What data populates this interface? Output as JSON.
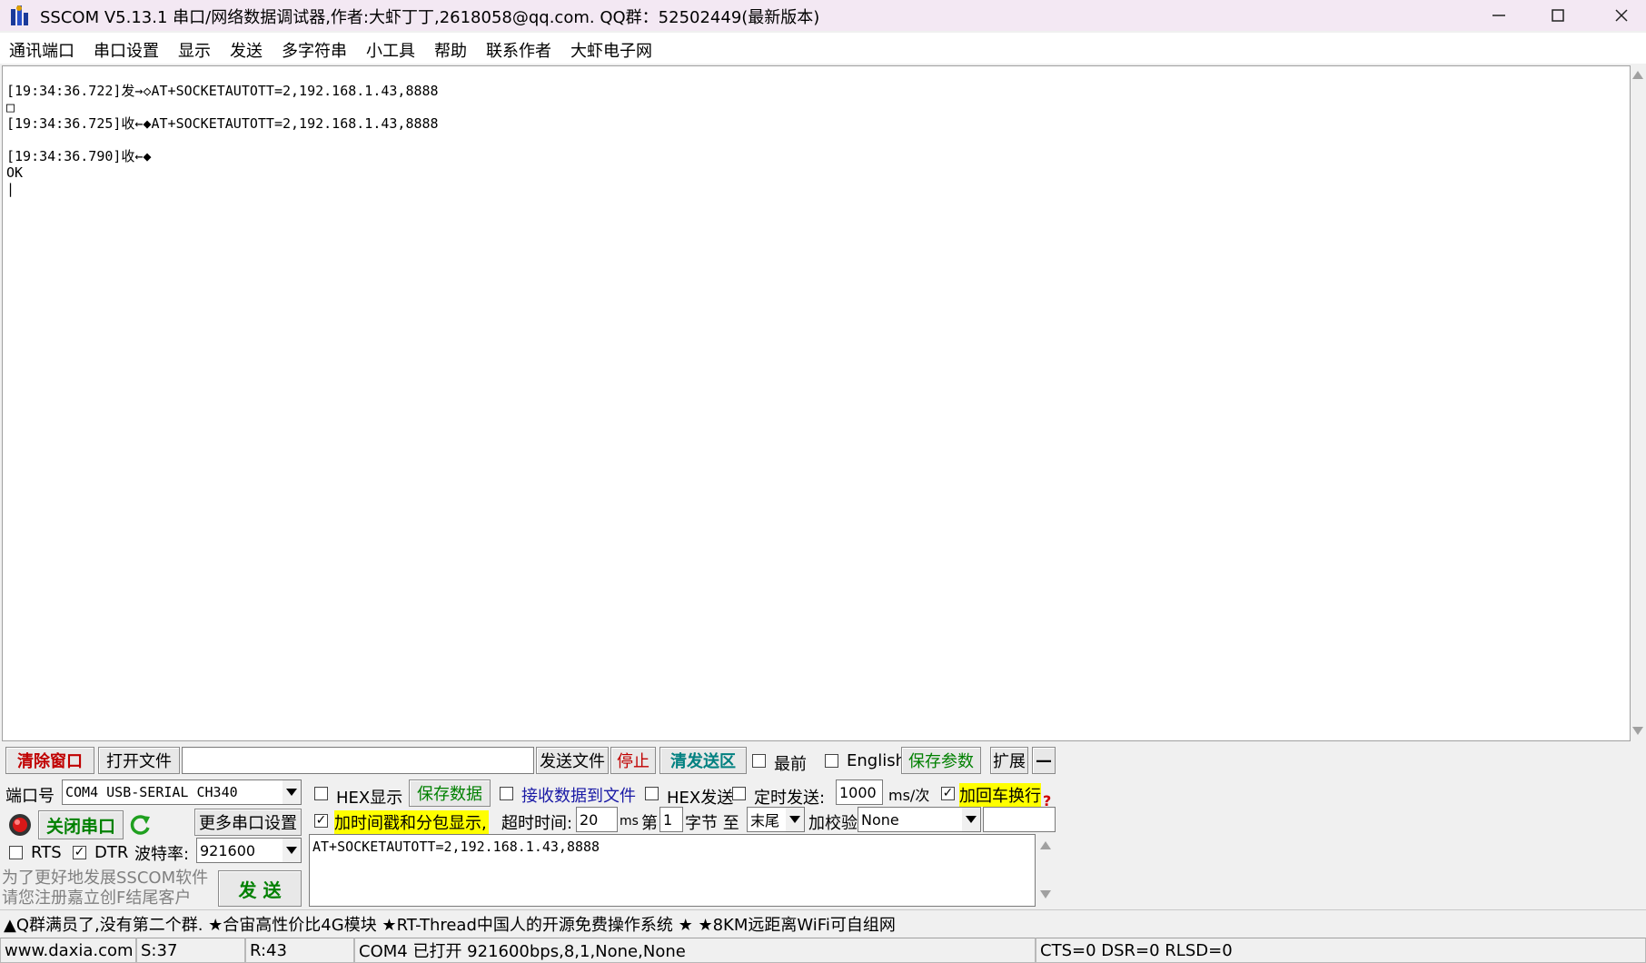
{
  "window": {
    "title": "SSCOM V5.13.1 串口/网络数据调试器,作者:大虾丁丁,2618058@qq.com. QQ群：52502449(最新版本)"
  },
  "menu": [
    "通讯端口",
    "串口设置",
    "显示",
    "发送",
    "多字符串",
    "小工具",
    "帮助",
    "联系作者",
    "大虾电子网"
  ],
  "output": {
    "lines": [
      "[19:34:36.722]发→◇AT+SOCKETAUTOTT=2,192.168.1.43,8888",
      "□",
      "[19:34:36.725]收←◆AT+SOCKETAUTOTT=2,192.168.1.43,8888",
      "",
      "[19:34:36.790]收←◆",
      "OK",
      "|"
    ]
  },
  "toolbar": {
    "clear_window": "清除窗口",
    "open_file": "打开文件",
    "file_path": "",
    "send_file": "发送文件",
    "stop": "停止",
    "clear_send": "清发送区",
    "topmost": "最前",
    "english": "English",
    "save_params": "保存参数",
    "expand": "扩展",
    "collapse": "—"
  },
  "port": {
    "port_label": "端口号",
    "port_value": "COM4 USB-SERIAL CH340",
    "close_port": "关闭串口",
    "more_settings": "更多串口设置",
    "rts": "RTS",
    "dtr": "DTR",
    "baud_label": "波特率:",
    "baud_value": "921600",
    "promo": [
      "为了更好地发展SSCOM软件",
      "请您注册嘉立创F结尾客户"
    ]
  },
  "options": {
    "hex_display": "HEX显示",
    "save_data": "保存数据",
    "recv_to_file": "接收数据到文件",
    "hex_send": "HEX发送",
    "timed_send": "定时发送:",
    "interval": "1000",
    "interval_unit": "ms/次",
    "add_crlf": "加回车换行",
    "timestamp": "加时间戳和分包显示,",
    "timeout_label": "超时时间:",
    "timeout_value": "20",
    "timeout_unit": "ms",
    "nth": "第",
    "nth_value": "1",
    "byte_to": "字节 至",
    "end": "末尾",
    "checksum_label": "加校验",
    "checksum_value": "None",
    "help": "?"
  },
  "send_box": {
    "text": "AT+SOCKETAUTOTT=2,192.168.1.43,8888",
    "send_button": "发  送"
  },
  "ad_bar": "▲Q群满员了,没有第二个群. ★合宙高性价比4G模块 ★RT-Thread中国人的开源免费操作系统 ★ ★8KM远距离WiFi可自组网",
  "status": {
    "website": "www.daxia.com",
    "sent": "S:37",
    "received": "R:43",
    "port_status": "COM4 已打开  921600bps,8,1,None,None",
    "signals": "CTS=0 DSR=0 RLSD=0"
  }
}
